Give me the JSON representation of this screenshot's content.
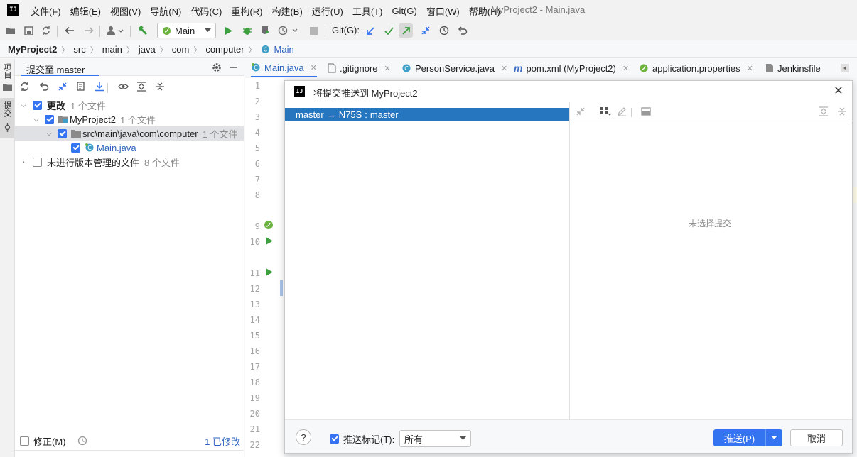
{
  "app": {
    "window_title": "MyProject2 - Main.java",
    "logo_text": "IJ"
  },
  "menu": [
    "文件(F)",
    "编辑(E)",
    "视图(V)",
    "导航(N)",
    "代码(C)",
    "重构(R)",
    "构建(B)",
    "运行(U)",
    "工具(T)",
    "Git(G)",
    "窗口(W)",
    "帮助(H)"
  ],
  "toolbar": {
    "run_config": "Main",
    "git_label": "Git(G):"
  },
  "breadcrumb": [
    "MyProject2",
    "src",
    "main",
    "java",
    "com",
    "computer",
    "Main"
  ],
  "left_stripe": {
    "project_tab": "项目",
    "commit_tab": "提交"
  },
  "commit_panel": {
    "title": "提交至 master",
    "tree": {
      "changes_label": "更改",
      "changes_count": "1 个文件",
      "project_label": "MyProject2",
      "project_count": "1 个文件",
      "path_label": "src\\main\\java\\com\\computer",
      "path_count": "1 个文件",
      "file_label": "Main.java",
      "unversioned_label": "未进行版本管理的文件",
      "unversioned_count": "8 个文件"
    },
    "amend_label": "修正(M)",
    "modified_count": "1 已修改"
  },
  "editor_tabs": [
    {
      "label": "Main.java",
      "icon": "class-icon"
    },
    {
      "label": ".gitignore",
      "icon": "file-icon"
    },
    {
      "label": "PersonService.java",
      "icon": "class-icon"
    },
    {
      "label": "pom.xml (MyProject2)",
      "icon": "maven-icon"
    },
    {
      "label": "application.properties",
      "icon": "spring-icon"
    },
    {
      "label": "Jenkinsfile",
      "icon": "file-icon"
    }
  ],
  "line_numbers": [
    "1",
    "2",
    "3",
    "4",
    "5",
    "6",
    "7",
    "8",
    "9",
    "10",
    "11",
    "12",
    "13",
    "14",
    "15",
    "16",
    "17",
    "18",
    "19",
    "20",
    "21",
    "22"
  ],
  "dialog": {
    "title": "将提交推送到 MyProject2",
    "commit_row": {
      "branch": "master",
      "arrow": "→",
      "remote": "N75S",
      "colon": ":",
      "target": "master"
    },
    "no_commit_selected": "未选择提交",
    "help_label": "?",
    "push_tags_label": "推送标记(T):",
    "push_tags_value": "所有",
    "push_button": "推送(P)",
    "cancel_button": "取消"
  },
  "colors": {
    "accent": "#3574f0",
    "selection": "#2675bf",
    "run_green": "#3c9e3c"
  }
}
